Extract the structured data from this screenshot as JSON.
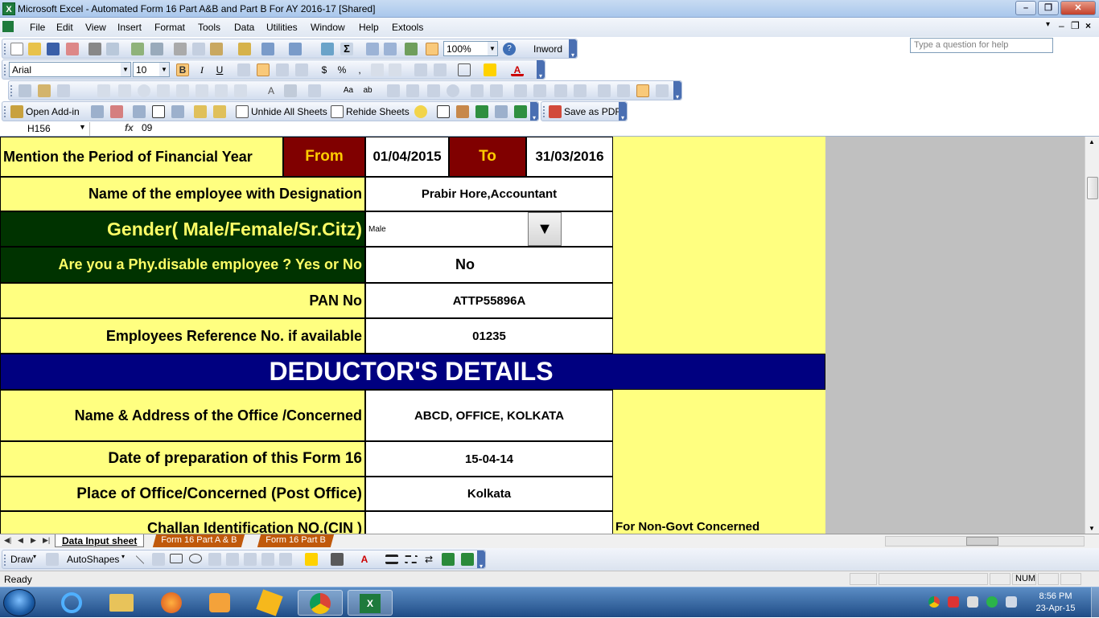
{
  "window": {
    "title": "Microsoft Excel - Automated Form 16 Part A&B and Part B For AY 2016-17  [Shared]",
    "controls": {
      "minimize": "–",
      "restore": "❐",
      "close": "✕"
    }
  },
  "menu": {
    "items": [
      "File",
      "Edit",
      "View",
      "Insert",
      "Format",
      "Tools",
      "Data",
      "Utilities",
      "Window",
      "Help",
      "Extools"
    ],
    "help_placeholder": "Type a question for help"
  },
  "toolbar_standard": {
    "zoom": "100%",
    "addin_label": "Inword"
  },
  "toolbar_format": {
    "font_name": "Arial",
    "font_size": "10",
    "bold": "B",
    "italic": "I",
    "underline": "U"
  },
  "toolbar_addins": {
    "open_addin": "Open Add-in",
    "unhide_sheets": "Unhide All Sheets",
    "rehide_sheets": "Rehide Sheets",
    "save_pdf": "Save as PDF"
  },
  "formula_bar": {
    "name_box": "H156",
    "fx": "fx",
    "value": "09"
  },
  "sheet": {
    "period": {
      "label": "Mention the Period of Financial Year",
      "from_label": "From",
      "from_value": "01/04/2015",
      "to_label": "To",
      "to_value": "31/03/2016"
    },
    "name": {
      "label": "Name of the employee with Designation",
      "value": "Prabir Hore,Accountant"
    },
    "gender": {
      "label": "Gender( Male/Female/Sr.Citz)",
      "value": "Male"
    },
    "disable": {
      "label": "Are you a Phy.disable employee ? Yes or No",
      "value": "No"
    },
    "pan": {
      "label": "PAN No",
      "value": "ATTP55896A"
    },
    "ref": {
      "label": "Employees Reference No. if available",
      "value": "01235"
    },
    "deductor_header": "DEDUCTOR'S DETAILS",
    "office": {
      "label": "Name  & Address of the Office /Concerned",
      "value": "ABCD, OFFICE, KOLKATA"
    },
    "date": {
      "label": "Date of preparation of this Form 16",
      "value": "15-04-14"
    },
    "place": {
      "label": "Place of Office/Concerned (Post Office)",
      "value": "Kolkata"
    },
    "challan": {
      "label": "Challan Identification NO.(CIN )",
      "note": "For Non-Govt Concerned"
    }
  },
  "tabs": [
    "Data Input sheet",
    "Form 16 Part A & B",
    "Form 16 Part B"
  ],
  "drawbar": {
    "draw": "Draw",
    "autoshapes": "AutoShapes"
  },
  "status": {
    "text": "Ready",
    "num": "NUM"
  },
  "clock": {
    "time": "8:56 PM",
    "date": "23-Apr-15"
  },
  "colors": {
    "sheet_yellow": "#ffff80",
    "dark_green": "#003300",
    "maroon": "#800000",
    "navy": "#000080"
  }
}
